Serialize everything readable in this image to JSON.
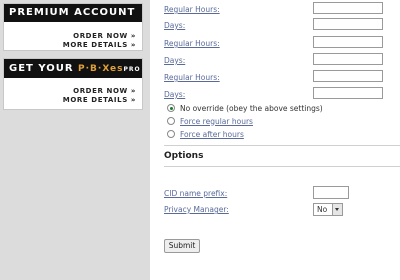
{
  "ads": {
    "premium": {
      "title": "PREMIUM ACCOUNT",
      "order": "ORDER NOW »",
      "details": "MORE DETAILS »"
    },
    "pbxes": {
      "title_prefix": "GET YOUR ",
      "brand": "P·B·Xes",
      "brand_suffix": "PRO",
      "order": "ORDER NOW »",
      "details": "MORE DETAILS »"
    }
  },
  "schedule": {
    "regular_hours_label": "Regular Hours:",
    "days_label": "Days:",
    "fields": [
      {
        "label": "Regular Hours:",
        "value": ""
      },
      {
        "label": "Days:",
        "value": ""
      },
      {
        "label": "Regular Hours:",
        "value": ""
      },
      {
        "label": "Days:",
        "value": ""
      },
      {
        "label": "Regular Hours:",
        "value": ""
      },
      {
        "label": "Days:",
        "value": ""
      }
    ]
  },
  "override": {
    "options": [
      {
        "label": "No override (obey the above settings)",
        "selected": true
      },
      {
        "label": "Force regular hours",
        "selected": false
      },
      {
        "label": "Force after hours",
        "selected": false
      }
    ]
  },
  "options": {
    "title": "Options",
    "cid_prefix_label": "CID name prefix:",
    "cid_prefix_value": "",
    "privacy_manager_label": "Privacy Manager:",
    "privacy_manager_value": "No"
  },
  "submit_label": "Submit",
  "colors": {
    "link": "#5a6a9a",
    "sidebar_bg": "#dcdcdc",
    "ad_bar": "#111111",
    "brand_accent": "#e0a13a"
  }
}
